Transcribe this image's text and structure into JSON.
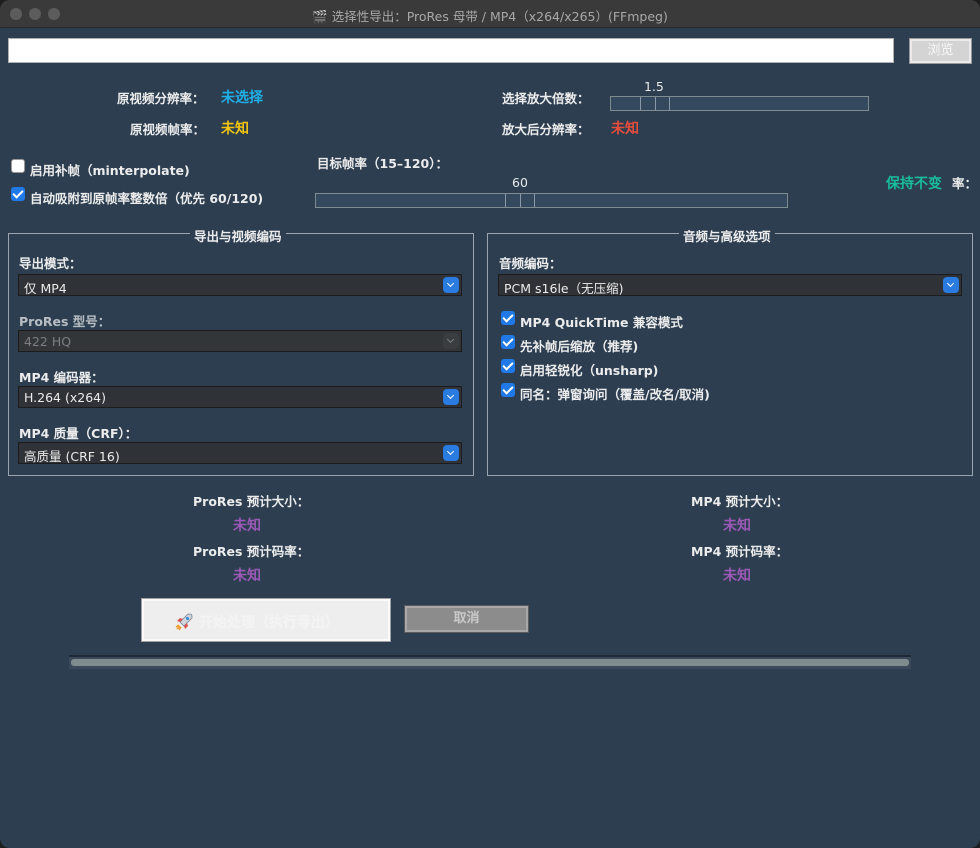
{
  "window": {
    "title": "选择性导出：ProRes 母带 / MP4（x264/x265）(FFmpeg)",
    "title_icon": "🎬"
  },
  "path_bar": {
    "value": "",
    "browse_label": "浏览"
  },
  "info": {
    "src_resolution_label": "原视频分辨率：",
    "src_resolution_value": "未选择",
    "src_fps_label": "原视频帧率：",
    "src_fps_value": "未知",
    "scale_label": "选择放大倍数：",
    "scale_value": "1.5",
    "scaled_res_label": "放大后分辨率：",
    "scaled_res_value": "未知"
  },
  "frame_interp": {
    "enable_label": "启用补帧（minterpolate)",
    "enable_checked": false,
    "snap_label": "自动吸附到原帧率整数倍（优先 60/120)",
    "snap_checked": true,
    "target_fps_label": "目标帧率（15–120）：",
    "target_fps_value": "60",
    "keep_label": "保持不变",
    "keep_suffix": "率："
  },
  "export_panel": {
    "title": "导出与视频编码",
    "mode_label": "导出模式：",
    "mode_value": "仅 MP4",
    "prores_label": "ProRes 型号：",
    "prores_value": "422 HQ",
    "encoder_label": "MP4 编码器：",
    "encoder_value": "H.264 (x264)",
    "quality_label": "MP4 质量（CRF）：",
    "quality_value": "高质量 (CRF 16)"
  },
  "audio_panel": {
    "title": "音频与高级选项",
    "codec_label": "音频编码：",
    "codec_value": "PCM s16le（无压缩)",
    "options": [
      {
        "label": "MP4 QuickTime 兼容模式",
        "checked": true
      },
      {
        "label": "先补帧后缩放（推荐)",
        "checked": true
      },
      {
        "label": "启用轻锐化（unsharp)",
        "checked": true
      },
      {
        "label": "同名：弹窗询问（覆盖/改名/取消)",
        "checked": true
      }
    ]
  },
  "estimates": {
    "prores_size_label": "ProRes 预计大小：",
    "prores_size_value": "未知",
    "prores_bitrate_label": "ProRes 预计码率：",
    "prores_bitrate_value": "未知",
    "mp4_size_label": "MP4 预计大小：",
    "mp4_size_value": "未知",
    "mp4_bitrate_label": "MP4 预计码率：",
    "mp4_bitrate_value": "未知"
  },
  "actions": {
    "start_label": "开始处理（执行导出）",
    "cancel_label": "取消"
  },
  "progress": {
    "value": 0
  },
  "colors": {
    "unselected_blue": "#1fb0e8",
    "unknown_yellow": "#f1c40f",
    "unknown_red": "#e74c3c",
    "unknown_purple": "#9b59b6",
    "keep_green": "#1abc9c",
    "accent": "#1f7ae8"
  }
}
